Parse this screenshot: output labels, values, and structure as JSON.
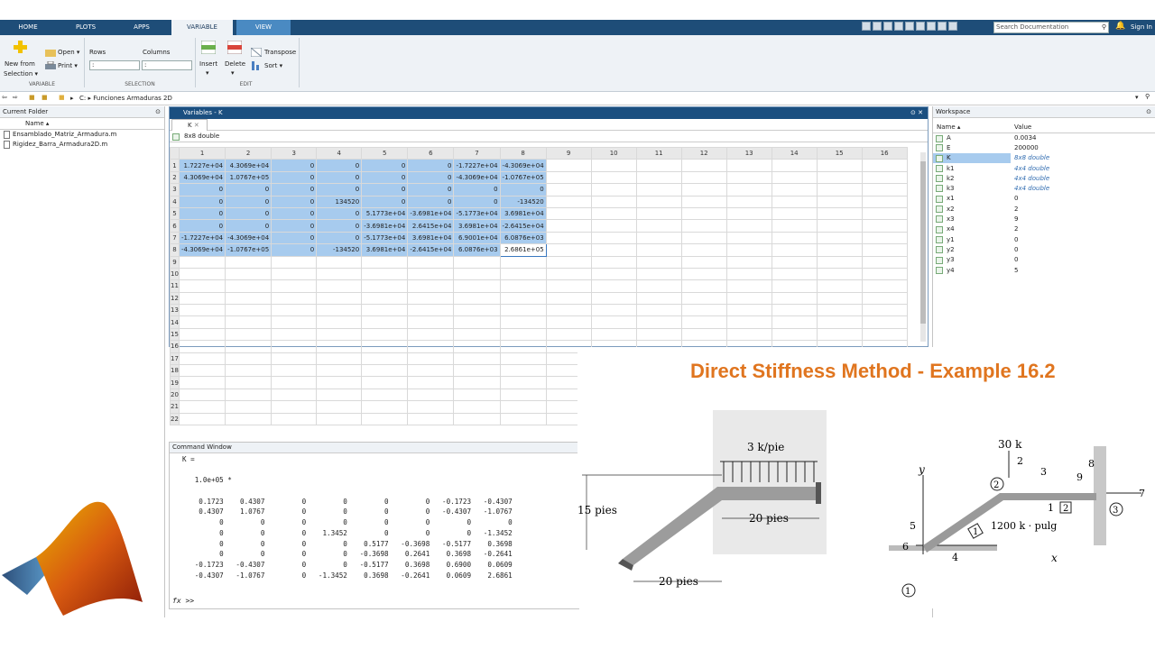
{
  "tabs": [
    "HOME",
    "PLOTS",
    "APPS",
    "VARIABLE",
    "VIEW"
  ],
  "search": {
    "placeholder": "Search Documentation"
  },
  "sign_in": "Sign In",
  "ribbon": {
    "new_from": "New from",
    "selection_btn": "Selection",
    "open": "Open",
    "print": "Print",
    "rows": "Rows",
    "columns": "Columns",
    "rows_value": ":",
    "columns_value": ":",
    "insert": "Insert",
    "delete": "Delete",
    "transpose": "Transpose",
    "sort": "Sort",
    "sec_variable": "VARIABLE",
    "sec_selection": "SELECTION",
    "sec_edit": "EDIT"
  },
  "address": {
    "drive": "C:",
    "sep": "▸",
    "folder": "Funciones Armaduras 2D"
  },
  "current_folder": {
    "title": "Current Folder",
    "name_header": "Name",
    "files": [
      "Ensamblado_Matriz_Armadura.m",
      "Rigidez_Barra_Armadura2D.m"
    ]
  },
  "variables": {
    "title": "Variables - K",
    "tab": "K",
    "size": "8x8 double",
    "col_headers": [
      "1",
      "2",
      "3",
      "4",
      "5",
      "6",
      "7",
      "8",
      "9",
      "10",
      "11",
      "12",
      "13",
      "14",
      "15",
      "16"
    ],
    "rows": [
      [
        "1.7227e+04",
        "4.3069e+04",
        "0",
        "0",
        "0",
        "0",
        "-1.7227e+04",
        "-4.3069e+04"
      ],
      [
        "4.3069e+04",
        "1.0767e+05",
        "0",
        "0",
        "0",
        "0",
        "-4.3069e+04",
        "-1.0767e+05"
      ],
      [
        "0",
        "0",
        "0",
        "0",
        "0",
        "0",
        "0",
        "0"
      ],
      [
        "0",
        "0",
        "0",
        "134520",
        "0",
        "0",
        "0",
        "-134520"
      ],
      [
        "0",
        "0",
        "0",
        "0",
        "5.1773e+04",
        "-3.6981e+04",
        "-5.1773e+04",
        "3.6981e+04"
      ],
      [
        "0",
        "0",
        "0",
        "0",
        "-3.6981e+04",
        "2.6415e+04",
        "3.6981e+04",
        "-2.6415e+04"
      ],
      [
        "-1.7227e+04",
        "-4.3069e+04",
        "0",
        "0",
        "-5.1773e+04",
        "3.6981e+04",
        "6.9001e+04",
        "6.0876e+03"
      ],
      [
        "-4.3069e+04",
        "-1.0767e+05",
        "0",
        "-134520",
        "3.6981e+04",
        "-2.6415e+04",
        "6.0876e+03",
        "2.6861e+05"
      ]
    ],
    "row_count": 22
  },
  "command": {
    "title": "Command Window",
    "lines": [
      "K =",
      "",
      "   1.0e+05 *",
      "",
      "    0.1723    0.4307         0         0         0         0   -0.1723   -0.4307",
      "    0.4307    1.0767         0         0         0         0   -0.4307   -1.0767",
      "         0         0         0         0         0         0         0         0",
      "         0         0         0    1.3452         0         0         0   -1.3452",
      "         0         0         0         0    0.5177   -0.3698   -0.5177    0.3698",
      "         0         0         0         0   -0.3698    0.2641    0.3698   -0.2641",
      "   -0.1723   -0.4307         0         0   -0.5177    0.3698    0.6900    0.0609",
      "   -0.4307   -1.0767         0   -1.3452    0.3698   -0.2641    0.0609    2.6861"
    ],
    "prompt": ">>"
  },
  "workspace": {
    "title": "Workspace",
    "name_header": "Name",
    "value_header": "Value",
    "items": [
      {
        "name": "A",
        "value": "0.0034"
      },
      {
        "name": "E",
        "value": "200000"
      },
      {
        "name": "K",
        "value": "8x8 double"
      },
      {
        "name": "k1",
        "value": "4x4 double"
      },
      {
        "name": "k2",
        "value": "4x4 double"
      },
      {
        "name": "k3",
        "value": "4x4 double"
      },
      {
        "name": "x1",
        "value": "0"
      },
      {
        "name": "x2",
        "value": "2"
      },
      {
        "name": "x3",
        "value": "9"
      },
      {
        "name": "x4",
        "value": "2"
      },
      {
        "name": "y1",
        "value": "0"
      },
      {
        "name": "y2",
        "value": "0"
      },
      {
        "name": "y3",
        "value": "0"
      },
      {
        "name": "y4",
        "value": "5"
      }
    ]
  },
  "overlay": {
    "title": "Direct Stiffness Method - Example 16.2",
    "load": "3 k/pie",
    "dim_15": "15 pies",
    "dim_20_top": "20 pies",
    "dim_20_bottom": "20 pies",
    "force_30": "30 k",
    "moment": "1200 k · pulg",
    "node_1": "1",
    "node_2": "2",
    "node_3": "3",
    "dof": [
      "1",
      "2",
      "3",
      "4",
      "5",
      "6",
      "7",
      "8",
      "9"
    ],
    "member_1": "1",
    "member_2": "2",
    "axis_x": "x",
    "axis_y": "y"
  },
  "colors": {
    "accent": "#e0751f",
    "tabbar": "#1e4d78",
    "selection": "#a7cbee"
  }
}
